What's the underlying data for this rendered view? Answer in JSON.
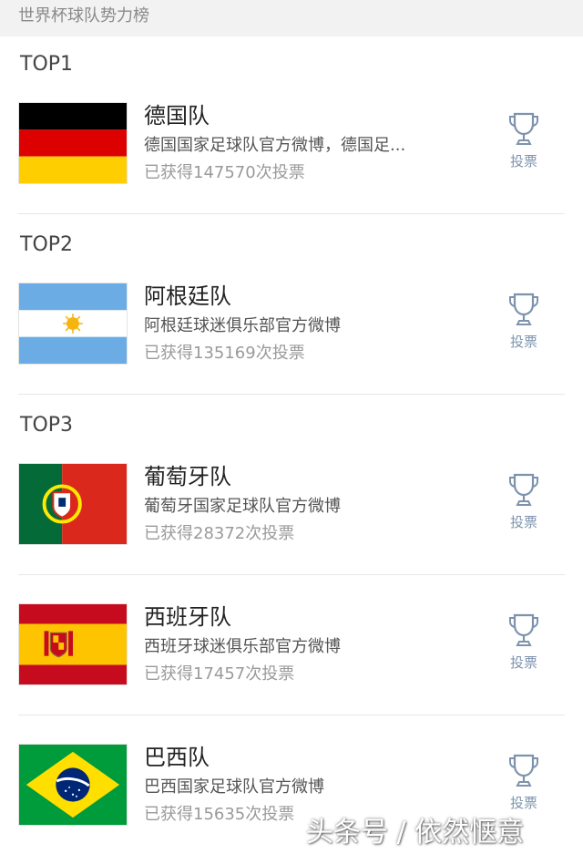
{
  "header": {
    "title": "世界杯球队势力榜"
  },
  "sections": {
    "top1": "TOP1",
    "top2": "TOP2",
    "top3": "TOP3"
  },
  "teams": [
    {
      "name": "德国队",
      "desc": "德国国家足球队官方微博，德国足...",
      "votes": "已获得147570次投票",
      "flag": "germany"
    },
    {
      "name": "阿根廷队",
      "desc": "阿根廷球迷俱乐部官方微博",
      "votes": "已获得135169次投票",
      "flag": "argentina"
    },
    {
      "name": "葡萄牙队",
      "desc": "葡萄牙国家足球队官方微博",
      "votes": "已获得28372次投票",
      "flag": "portugal"
    },
    {
      "name": "西班牙队",
      "desc": "西班牙球迷俱乐部官方微博",
      "votes": "已获得17457次投票",
      "flag": "spain"
    },
    {
      "name": "巴西队",
      "desc": "巴西国家足球队官方微博",
      "votes": "已获得15635次投票",
      "flag": "brazil"
    }
  ],
  "vote_label": "投票",
  "watermark": "头条号 / 依然惬意",
  "colors": {
    "accent": "#7d93ad",
    "divider": "#e8e8e8"
  },
  "icons": {
    "vote": "trophy-icon"
  }
}
